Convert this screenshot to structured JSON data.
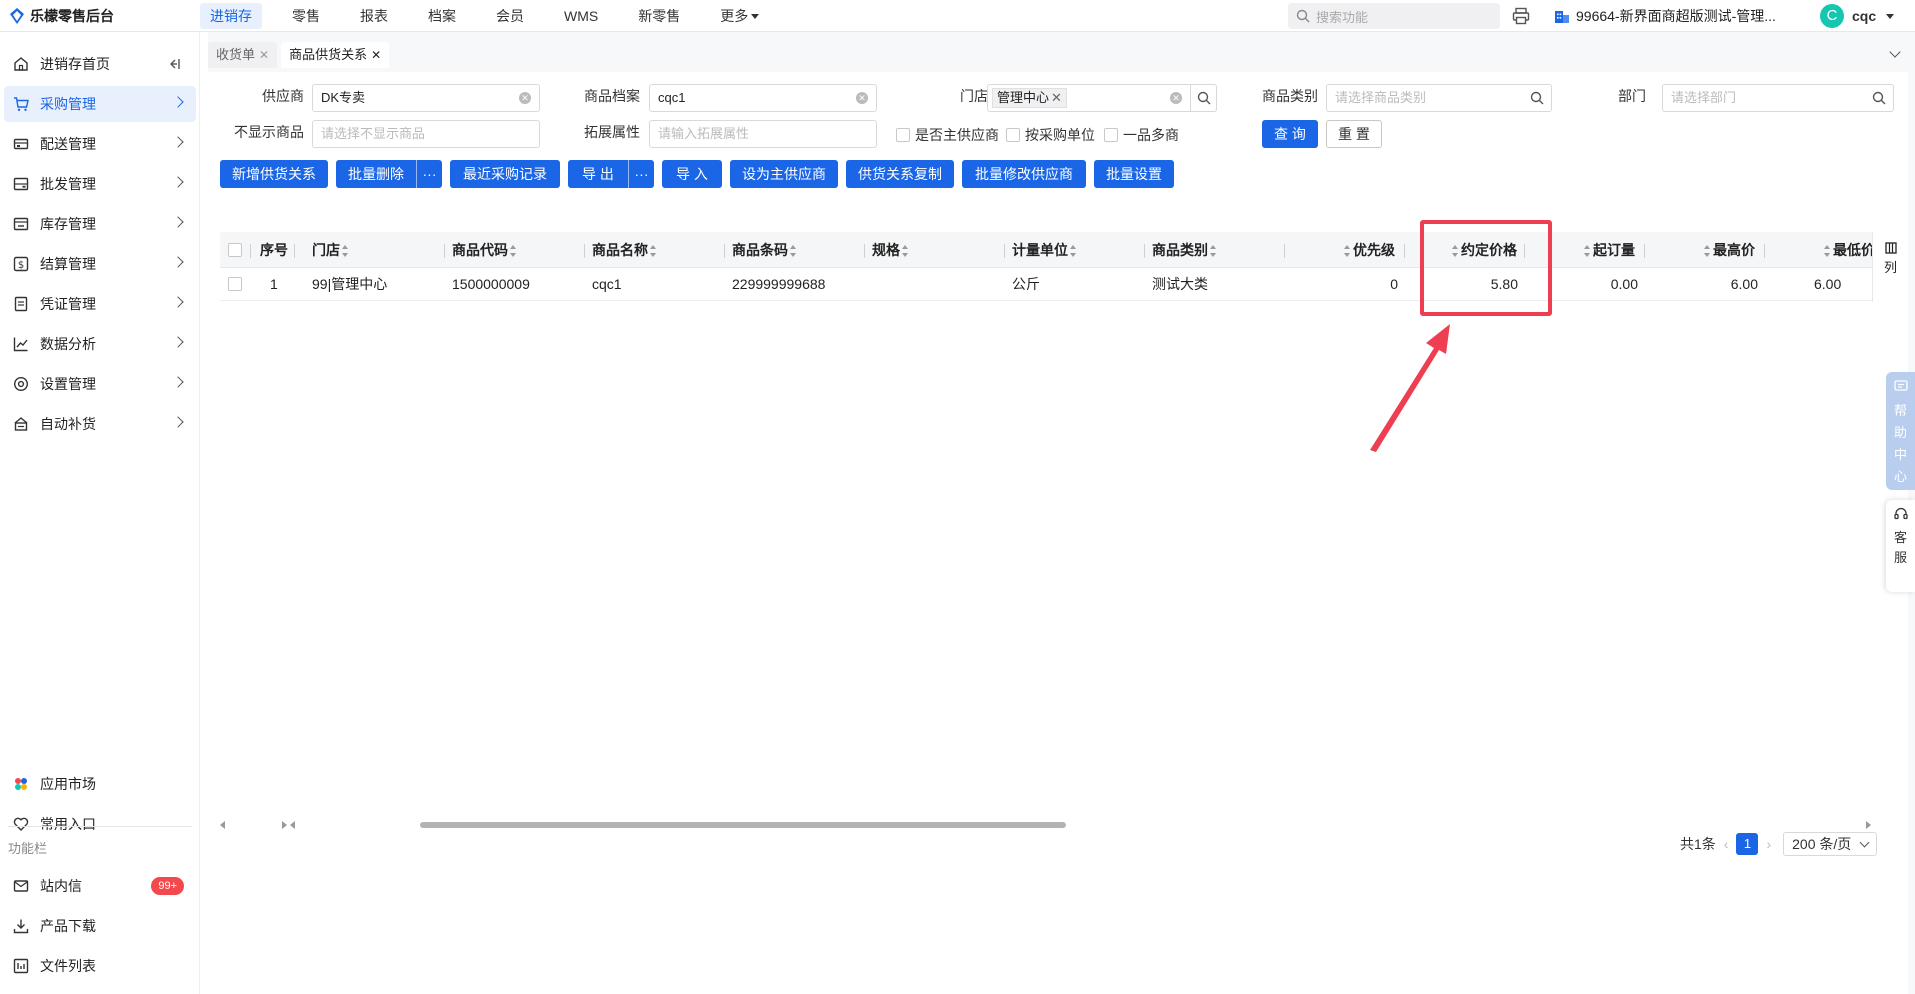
{
  "app": {
    "title": "乐檬零售后台"
  },
  "topnav": [
    {
      "label": "进销存",
      "active": true
    },
    {
      "label": "零售"
    },
    {
      "label": "报表"
    },
    {
      "label": "档案"
    },
    {
      "label": "会员"
    },
    {
      "label": "WMS"
    },
    {
      "label": "新零售"
    },
    {
      "label": "更多"
    }
  ],
  "top_search": {
    "placeholder": "搜索功能"
  },
  "tenant": "99664-新界面商超版测试-管理...",
  "user": {
    "avatar_letter": "C",
    "name": "cqc"
  },
  "sidebar": {
    "items": [
      {
        "label": "进销存首页"
      },
      {
        "label": "采购管理",
        "active": true
      },
      {
        "label": "配送管理"
      },
      {
        "label": "批发管理"
      },
      {
        "label": "库存管理"
      },
      {
        "label": "结算管理"
      },
      {
        "label": "凭证管理"
      },
      {
        "label": "数据分析"
      },
      {
        "label": "设置管理"
      },
      {
        "label": "自动补货"
      }
    ],
    "bottom": [
      {
        "label": "应用市场"
      },
      {
        "label": "常用入口"
      }
    ],
    "section_label": "功能栏",
    "extras": [
      {
        "label": "站内信",
        "badge": "99+"
      },
      {
        "label": "产品下载"
      },
      {
        "label": "文件列表"
      }
    ]
  },
  "tabs": [
    {
      "label": "收货单"
    },
    {
      "label": "商品供货关系",
      "active": true
    }
  ],
  "filters": {
    "supplier": {
      "label": "供应商",
      "value": "DK专卖"
    },
    "product": {
      "label": "商品档案",
      "value": "cqc1"
    },
    "store": {
      "label": "门店",
      "tag": "管理中心"
    },
    "category": {
      "label": "商品类别",
      "placeholder": "请选择商品类别"
    },
    "department": {
      "label": "部门",
      "placeholder": "请选择部门"
    },
    "hide_product": {
      "label": "不显示商品",
      "placeholder": "请选择不显示商品"
    },
    "ext_attr": {
      "label": "拓展属性",
      "placeholder": "请输入拓展属性"
    },
    "checkbox_main": "是否主供应商",
    "checkbox_unit": "按采购单位",
    "checkbox_multi": "一品多商",
    "query_button": "查 询",
    "reset_button": "重 置"
  },
  "toolbar": {
    "add": "新增供货关系",
    "batch_delete": "批量删除",
    "more": "···",
    "recent": "最近采购记录",
    "export": "导 出",
    "import": "导 入",
    "set_main": "设为主供应商",
    "copy": "供货关系复制",
    "batch_modify": "批量修改供应商",
    "batch_set": "批量设置"
  },
  "table": {
    "columns": [
      "序号",
      "门店",
      "商品代码",
      "商品名称",
      "商品条码",
      "规格",
      "计量单位",
      "商品类别",
      "优先级",
      "约定价格",
      "起订量",
      "最高价",
      "最低价"
    ],
    "column_toggle": "列",
    "rows": [
      {
        "index": "1",
        "store": "99|管理中心",
        "code": "1500000009",
        "name": "cqc1",
        "barcode": "229999999688",
        "spec": "",
        "unit": "公斤",
        "category": "测试大类",
        "priority": "0",
        "agreed_price": "5.80",
        "min_order": "0.00",
        "max_price": "6.00",
        "min_price": "6.00"
      }
    ]
  },
  "pagination": {
    "total": "共1条",
    "current": "1",
    "page_size": "200 条/页"
  },
  "float": {
    "help": [
      "帮",
      "助",
      "中",
      "心"
    ],
    "service": [
      "客",
      "服"
    ]
  },
  "colors": {
    "primary": "#1a66e6",
    "highlight": "#ee3f52",
    "badge": "#f5484c"
  }
}
